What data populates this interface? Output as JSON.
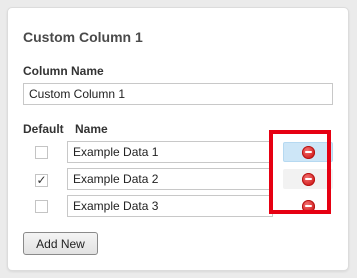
{
  "panel": {
    "title": "Custom Column 1",
    "column_name_label": "Column Name",
    "column_name_value": "Custom Column 1",
    "headers": {
      "default": "Default",
      "name": "Name"
    },
    "rows": [
      {
        "name": "Example Data 1",
        "default": false,
        "delete_icon": "minus-circle-icon"
      },
      {
        "name": "Example Data 2",
        "default": true,
        "delete_icon": "minus-circle-icon"
      },
      {
        "name": "Example Data 3",
        "default": false,
        "delete_icon": "minus-circle-icon"
      }
    ],
    "add_button_label": "Add New"
  },
  "colors": {
    "highlight": "#e60012",
    "delete_icon": "#d42020",
    "hover_bg": "#cde6f7"
  }
}
